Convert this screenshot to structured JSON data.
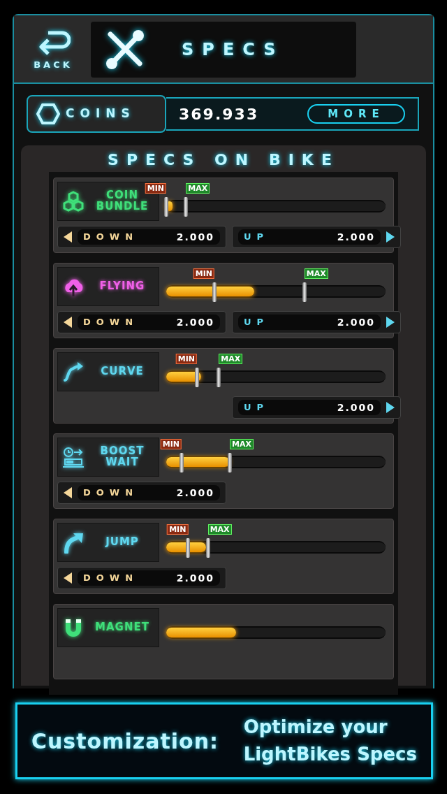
{
  "header": {
    "back_label": "BACK",
    "title": "SPECS"
  },
  "coins": {
    "label": "COINS",
    "amount": "369.933",
    "more_button": "MORE"
  },
  "panel_title": "SPECS ON BIKE",
  "specs": [
    {
      "name": "COIN BUNDLE",
      "color": "#3fe07a",
      "level": 0.03,
      "min_marker": {
        "label": "MIN",
        "level": 0.0
      },
      "max_marker": {
        "label": "MAX",
        "level": 0.09
      },
      "down": {
        "label": "DOWN",
        "value": "2.000"
      },
      "up": {
        "label": "UP",
        "value": "2.000"
      }
    },
    {
      "name": "FLYING",
      "color": "#f060e8",
      "level": 0.4,
      "min_marker": {
        "label": "MIN",
        "level": 0.22
      },
      "max_marker": {
        "label": "MAX",
        "level": 0.63
      },
      "down": {
        "label": "DOWN",
        "value": "2.000"
      },
      "up": {
        "label": "UP",
        "value": "2.000"
      }
    },
    {
      "name": "CURVE",
      "color": "#5fd8f0",
      "level": 0.16,
      "min_marker": {
        "label": "MIN",
        "level": 0.14
      },
      "max_marker": {
        "label": "MAX",
        "level": 0.24
      },
      "up": {
        "label": "UP",
        "value": "2.000"
      }
    },
    {
      "name": "BOOST WAIT",
      "color": "#5fd8f0",
      "level": 0.29,
      "min_marker": {
        "label": "MIN",
        "level": 0.07
      },
      "max_marker": {
        "label": "MAX",
        "level": 0.29
      },
      "down": {
        "label": "DOWN",
        "value": "2.000"
      }
    },
    {
      "name": "JUMP",
      "color": "#5fd8f0",
      "level": 0.18,
      "min_marker": {
        "label": "MIN",
        "level": 0.1
      },
      "max_marker": {
        "label": "MAX",
        "level": 0.19
      },
      "down": {
        "label": "DOWN",
        "value": "2.000"
      }
    },
    {
      "name": "MAGNET",
      "color": "#3fe07a",
      "level": 0.32
    }
  ],
  "banner": {
    "heading": "Customization:",
    "line_1": "Optimize your",
    "line_2": "LightBikes Specs"
  }
}
